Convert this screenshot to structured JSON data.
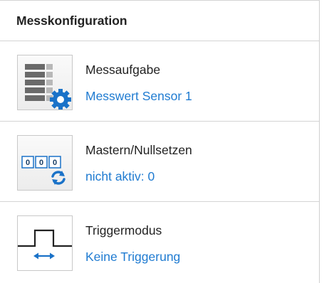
{
  "header": {
    "title": "Messkonfiguration"
  },
  "items": [
    {
      "title": "Messaufgabe",
      "value": "Messwert Sensor 1",
      "icon": "measurement-task-gear-icon"
    },
    {
      "title": "Mastern/Nullsetzen",
      "value": "nicht aktiv: 0",
      "icon": "zero-reset-counter-icon",
      "counter_digits": [
        "0",
        "0",
        "0"
      ]
    },
    {
      "title": "Triggermodus",
      "value": "Keine Triggerung",
      "icon": "trigger-pulse-icon"
    }
  ],
  "colors": {
    "value_link": "#1f7bd1",
    "title_text": "#222222",
    "divider": "#d4d4d4",
    "gear_blue": "#1a72c8"
  }
}
